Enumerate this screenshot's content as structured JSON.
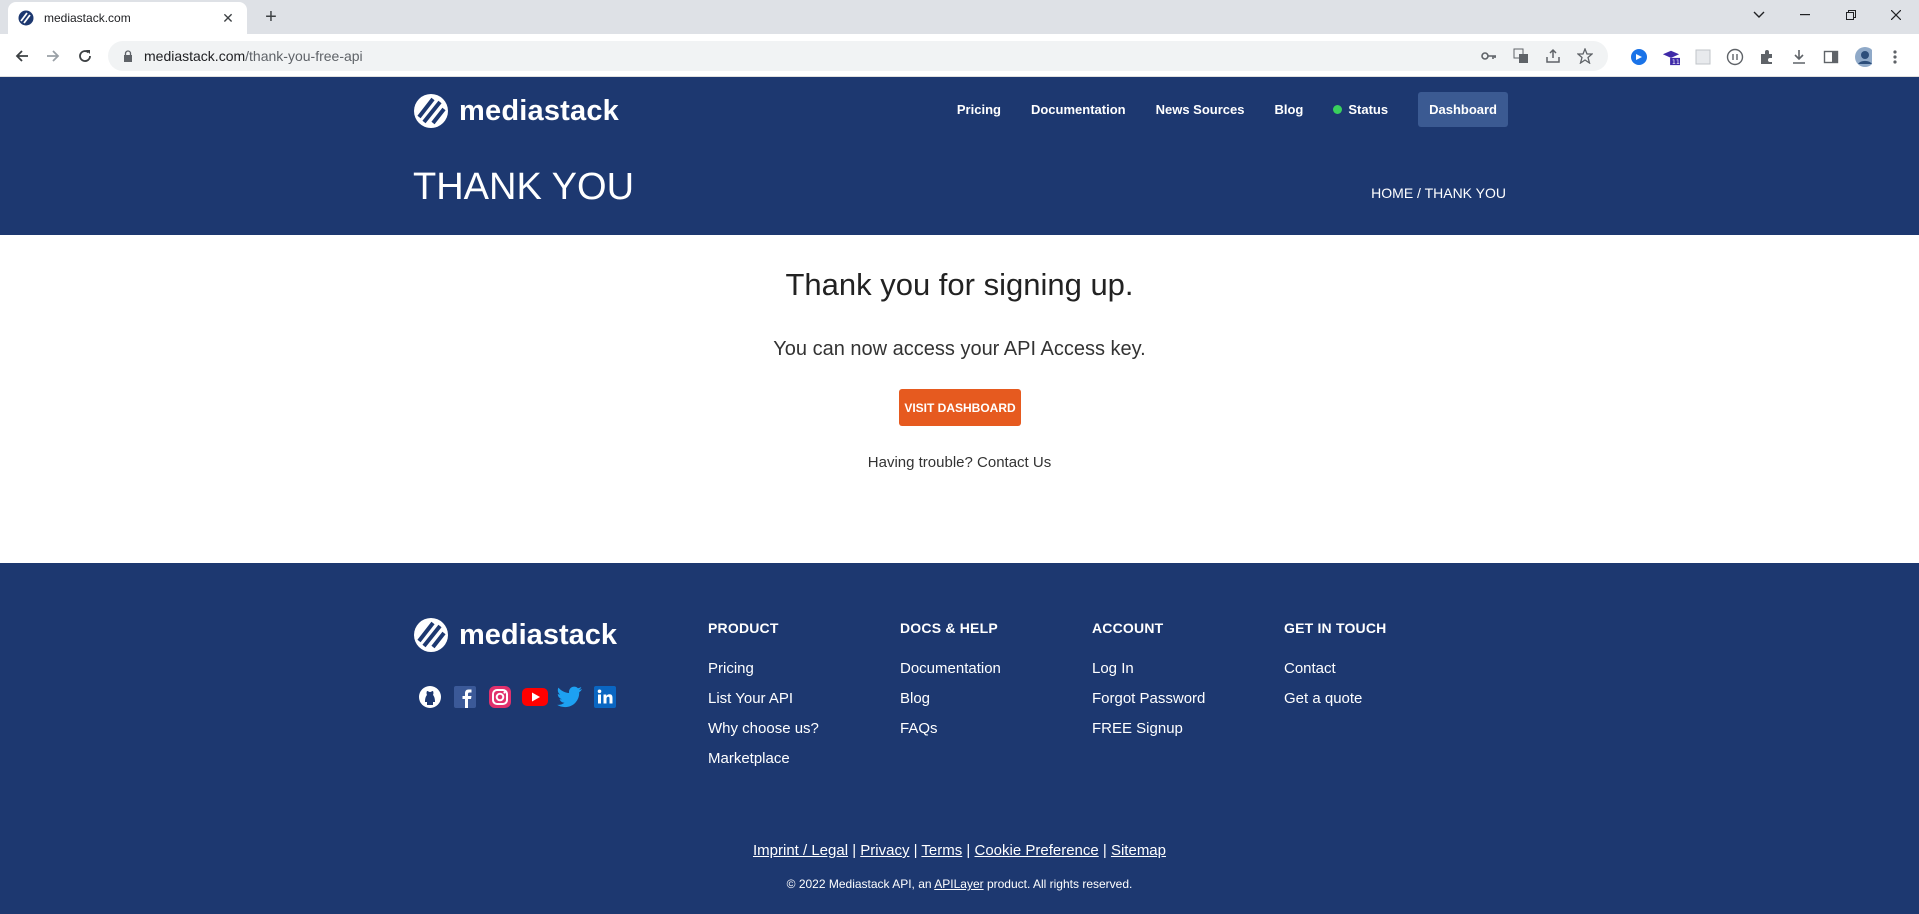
{
  "browser": {
    "tab_title": "mediastack.com",
    "url_host": "mediastack.com",
    "url_path": "/thank-you-free-api"
  },
  "header": {
    "brand": "mediastack",
    "nav": {
      "pricing": "Pricing",
      "documentation": "Documentation",
      "news_sources": "News Sources",
      "blog": "Blog",
      "status": "Status",
      "dashboard": "Dashboard"
    },
    "page_title": "THANK YOU",
    "breadcrumb": "HOME / THANK YOU",
    "status_color": "#39d05c"
  },
  "main": {
    "heading": "Thank you for signing up.",
    "subheading": "You can now access your API Access key.",
    "button": "VISIT DASHBOARD",
    "trouble": "Having trouble? Contact Us"
  },
  "footer": {
    "brand": "mediastack",
    "social": [
      "github-icon",
      "facebook-icon",
      "instagram-icon",
      "youtube-icon",
      "twitter-icon",
      "linkedin-icon"
    ],
    "columns": [
      {
        "heading": "PRODUCT",
        "items": [
          "Pricing",
          "List Your API",
          "Why choose us?",
          "Marketplace"
        ]
      },
      {
        "heading": "DOCS & HELP",
        "items": [
          "Documentation",
          "Blog",
          "FAQs"
        ]
      },
      {
        "heading": "ACCOUNT",
        "items": [
          "Log In",
          "Forgot Password",
          "FREE Signup"
        ]
      },
      {
        "heading": "GET IN TOUCH",
        "items": [
          "Contact",
          "Get a quote"
        ]
      }
    ],
    "legal": [
      "Imprint / Legal",
      "Privacy",
      "Terms",
      "Cookie Preference",
      "Sitemap"
    ],
    "copyright_pre": "© 2022 Mediastack API, an ",
    "copyright_link": "APILayer",
    "copyright_post": " product. All rights reserved."
  },
  "colors": {
    "brand_blue": "#1d3870",
    "accent_orange": "#e65a1f"
  }
}
